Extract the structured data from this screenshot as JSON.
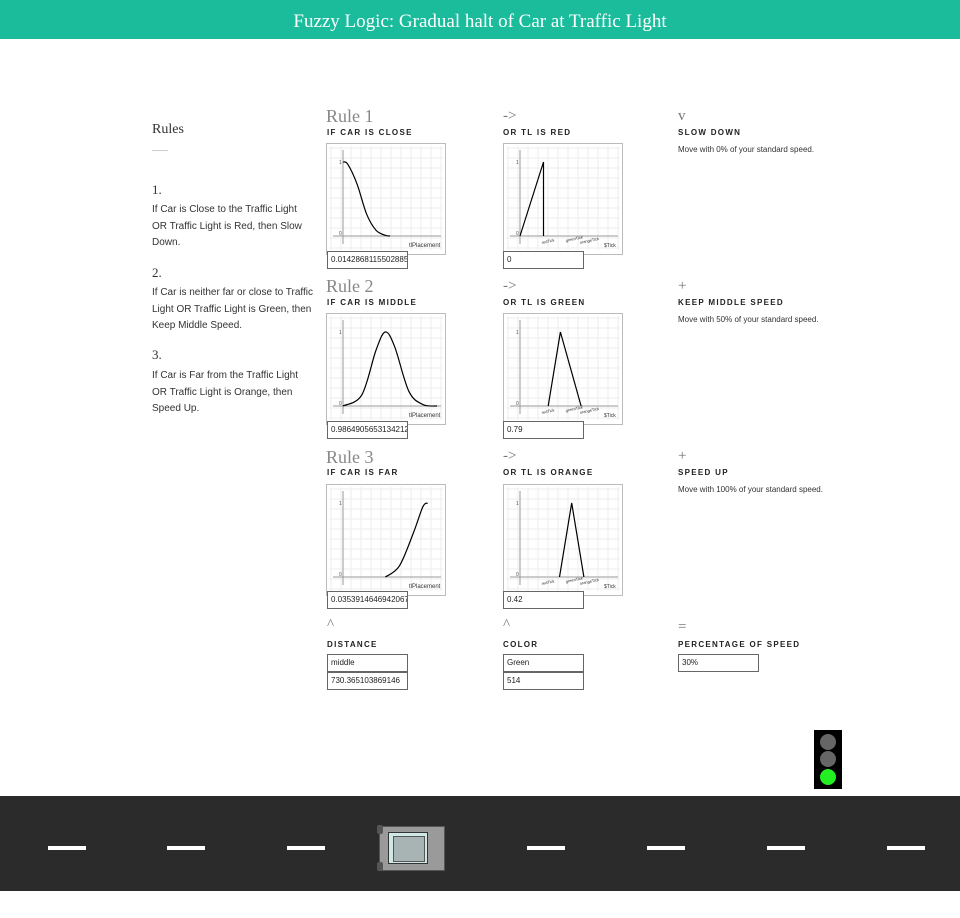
{
  "header": {
    "title": "Fuzzy Logic: Gradual halt of Car at Traffic Light"
  },
  "sidebar": {
    "title": "Rules",
    "rules": [
      {
        "num": "1.",
        "text": "If Car is Close to the Traffic Light OR Traffic Light is Red, then Slow Down."
      },
      {
        "num": "2.",
        "text": "If Car is neither far or close to Traffic Light OR Traffic Light is Green, then Keep Middle Speed."
      },
      {
        "num": "3.",
        "text": "If Car is Far from the Traffic Light OR Traffic Light is Orange, then Speed Up."
      }
    ]
  },
  "rules": [
    {
      "title": "Rule 1",
      "arrow": "->",
      "op": "v",
      "dist_label": "IF CAR IS CLOSE",
      "color_label": "OR TL IS RED",
      "action_label": "SLOW DOWN",
      "action_desc": "Move with 0% of your standard speed.",
      "dist_value": "0.01428681155028858",
      "color_value": "0"
    },
    {
      "title": "Rule 2",
      "arrow": "->",
      "op": "+",
      "dist_label": "IF CAR IS MIDDLE",
      "color_label": "OR TL IS GREEN",
      "action_label": "KEEP MIDDLE SPEED",
      "action_desc": "Move with 50% of your standard speed.",
      "dist_value": "0.9864905653134212",
      "color_value": "0.79"
    },
    {
      "title": "Rule 3",
      "arrow": "->",
      "op": "+",
      "dist_label": "IF CAR IS FAR",
      "color_label": "OR TL IS ORANGE",
      "action_label": "SPEED UP",
      "action_desc": "Move with 100% of your standard speed.",
      "dist_value": "0.03539146469420674",
      "color_value": "0.42"
    }
  ],
  "plot_labels": {
    "dist_x": "tlPlacement",
    "color_x": [
      "redTick",
      "greenTick",
      "orangeTick",
      "$Tick"
    ],
    "y_one": "1",
    "y_zero": "0"
  },
  "summary": {
    "dist_op": "^",
    "color_op": "^",
    "speed_op": "=",
    "dist_label": "DISTANCE",
    "color_label": "COLOR",
    "speed_label": "PERCENTAGE OF SPEED",
    "dist_text": "middle",
    "dist_num": "730.365103869146",
    "color_text": "Green",
    "color_num": "514",
    "speed_value": "30%"
  },
  "traffic_light": {
    "active": "green",
    "colors": {
      "off": "#666666",
      "green": "#22ee22"
    }
  },
  "chart_data": [
    {
      "type": "line",
      "title": "IF CAR IS CLOSE",
      "xlabel": "tlPlacement",
      "ylim": [
        0,
        1
      ],
      "series": [
        {
          "x": [
            0,
            0.05,
            0.15,
            0.25,
            0.35,
            0.45,
            0.5
          ],
          "values": [
            1,
            0.97,
            0.7,
            0.3,
            0.08,
            0.01,
            0
          ]
        }
      ]
    },
    {
      "type": "line",
      "title": "OR TL IS RED",
      "ylim": [
        0,
        1
      ],
      "series": [
        {
          "x": [
            0,
            0.25,
            0.25
          ],
          "values": [
            0,
            1,
            0
          ]
        }
      ]
    },
    {
      "type": "line",
      "title": "IF CAR IS MIDDLE",
      "xlabel": "tlPlacement",
      "ylim": [
        0,
        1
      ],
      "series": [
        {
          "x": [
            0,
            0.2,
            0.35,
            0.45,
            0.55,
            0.7,
            0.85,
            1
          ],
          "values": [
            0,
            0.15,
            0.75,
            1,
            0.8,
            0.2,
            0.02,
            0
          ]
        }
      ]
    },
    {
      "type": "line",
      "title": "OR TL IS GREEN",
      "ylim": [
        0,
        1
      ],
      "series": [
        {
          "x": [
            0.3,
            0.43,
            0.65
          ],
          "values": [
            0,
            1,
            0
          ]
        }
      ]
    },
    {
      "type": "line",
      "title": "IF CAR IS FAR",
      "xlabel": "tlPlacement",
      "ylim": [
        0,
        1
      ],
      "series": [
        {
          "x": [
            0.45,
            0.6,
            0.75,
            0.85,
            0.9
          ],
          "values": [
            0,
            0.15,
            0.6,
            0.95,
            1
          ]
        }
      ]
    },
    {
      "type": "line",
      "title": "OR TL IS ORANGE",
      "ylim": [
        0,
        1
      ],
      "series": [
        {
          "x": [
            0.42,
            0.55,
            0.68
          ],
          "values": [
            0,
            1,
            0
          ]
        }
      ]
    }
  ]
}
